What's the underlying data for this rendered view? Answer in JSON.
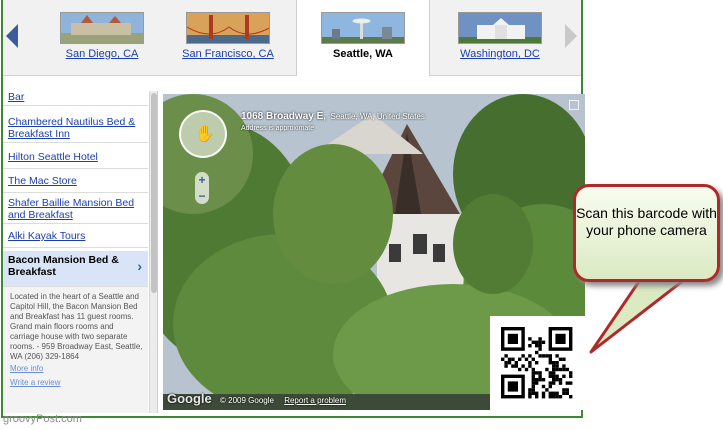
{
  "cities": [
    {
      "name": "San Diego, CA",
      "active": false
    },
    {
      "name": "San Francisco, CA",
      "active": false
    },
    {
      "name": "Seattle, WA",
      "active": true
    },
    {
      "name": "Washington, DC",
      "active": false
    }
  ],
  "sidebar": {
    "items": [
      {
        "label": "Bar"
      },
      {
        "label": "Chambered Nautilus Bed & Breakfast Inn"
      },
      {
        "label": "Hilton Seattle Hotel"
      },
      {
        "label": "The Mac Store"
      },
      {
        "label": "Shafer Baillie Mansion Bed and Breakfast"
      },
      {
        "label": "Alki Kayak Tours"
      }
    ],
    "selected": {
      "label": "Bacon Mansion Bed & Breakfast",
      "description": "Located in the heart of a Seattle and Capitol Hill, the Bacon Mansion Bed and Breakfast has 11 guest rooms. Grand main floors rooms and carriage house with two separate rooms. - 959 Broadway East, Seattle, WA (206) 329-1864",
      "more_info": "More info",
      "write_review": "Write a review"
    }
  },
  "streetview": {
    "address": "1068 Broadway E,",
    "city": "Seattle, WA, United States",
    "approx": "Address is approximate",
    "google": "Google",
    "copyright": "© 2009 Google",
    "report": "Report a problem"
  },
  "callout": {
    "text": "Scan this barcode with your phone camera"
  },
  "watermark": "groovyPost.com",
  "colors": {
    "link": "#1a3fb0",
    "frame": "#3c8a32",
    "callout_border": "#b0282a"
  }
}
